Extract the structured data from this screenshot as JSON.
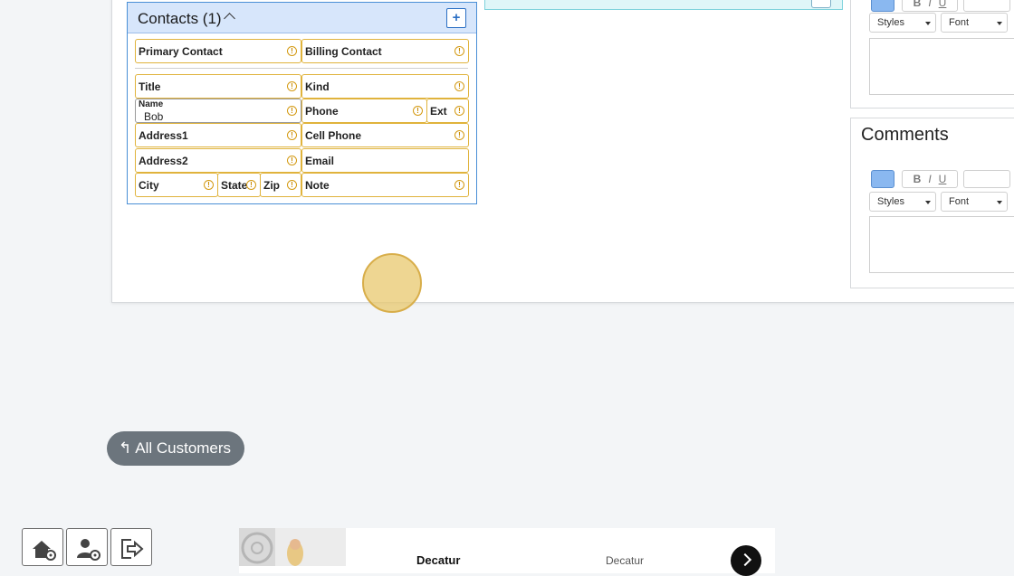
{
  "contacts": {
    "title": "Contacts (1)",
    "add_label": "+",
    "fields": {
      "primary_contact": "Primary Contact",
      "billing_contact": "Billing Contact",
      "title": "Title",
      "kind": "Kind",
      "name_label": "Name",
      "name_value": "Bob",
      "phone": "Phone",
      "ext": "Ext",
      "address1": "Address1",
      "cell_phone": "Cell Phone",
      "address2": "Address2",
      "email": "Email",
      "city": "City",
      "state": "State",
      "zip": "Zip",
      "note": "Note"
    },
    "info_glyph": "!"
  },
  "editor_top": {
    "bold": "B",
    "italic": "I",
    "underline": "U",
    "styles": "Styles",
    "font": "Font"
  },
  "comments": {
    "title": "Comments",
    "bold": "B",
    "italic": "I",
    "underline": "U",
    "styles": "Styles",
    "font": "Font"
  },
  "nav": {
    "all_customers": "All Customers",
    "back_glyph": "↰"
  },
  "footer": {
    "home_icon": "home-gear-icon",
    "user_icon": "user-gear-icon",
    "logout_icon": "logout-icon"
  },
  "listing": {
    "name": "Decatur",
    "city": "Decatur"
  },
  "colors": {
    "accent": "#4a8fd6",
    "field_border": "#e0b33c",
    "pill": "#6c757d"
  }
}
